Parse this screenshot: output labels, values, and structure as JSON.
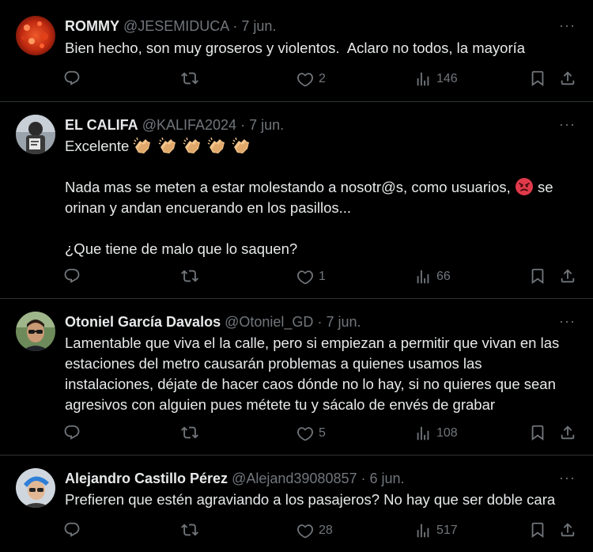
{
  "tweets": [
    {
      "name": "ROMMY",
      "handle": "@JESEMIDUCA",
      "date": "7 jun.",
      "text": "Bien hecho, son muy groseros y violentos.  Aclaro no todos, la mayoría",
      "likes": "2",
      "views": "146"
    },
    {
      "name": "EL CALIFA",
      "handle": "@KALIFA2024",
      "date": "7 jun.",
      "text_line1_prefix": "Excelente ",
      "text_para2_a": "Nada mas se meten a estar molestando a nosotr@s, como usuarios, ",
      "text_para2_b": " se",
      "text_para2_c": "orinan y andan encuerando en los pasillos...",
      "text_para3": "¿Que tiene de malo que lo saquen?",
      "likes": "1",
      "views": "66",
      "emojis": [
        "clapping-hands-emoji",
        "clapping-hands-emoji",
        "clapping-hands-emoji",
        "clapping-hands-emoji",
        "clapping-hands-emoji",
        "angry-face-emoji"
      ]
    },
    {
      "name": "Otoniel García Davalos",
      "handle": "@Otoniel_GD",
      "date": "7 jun.",
      "text": "Lamentable que viva el la calle, pero si empiezan a permitir que vivan en las\nestaciones del metro causarán problemas a quienes usamos las\ninstalaciones, déjate de hacer caos dónde no lo hay, si no quieres que sean\nagresivos con alguien pues métete tu y sácalo de envés de grabar",
      "likes": "5",
      "views": "108"
    },
    {
      "name": "Alejandro Castillo Pérez",
      "handle": "@Alejand39080857",
      "date": "6 jun.",
      "text": "Prefieren que estén agraviando a los pasajeros? No hay que ser doble cara",
      "likes": "28",
      "views": "517"
    }
  ],
  "ui": {
    "separator_dot": "·",
    "more_label": "···"
  },
  "colors": {
    "background": "#000000",
    "text_primary": "#e7e9ea",
    "text_secondary": "#71767b",
    "divider": "#2f3336"
  },
  "icons": [
    "reply-icon",
    "retweet-icon",
    "like-icon",
    "views-icon",
    "bookmark-icon",
    "share-icon",
    "more-icon"
  ]
}
